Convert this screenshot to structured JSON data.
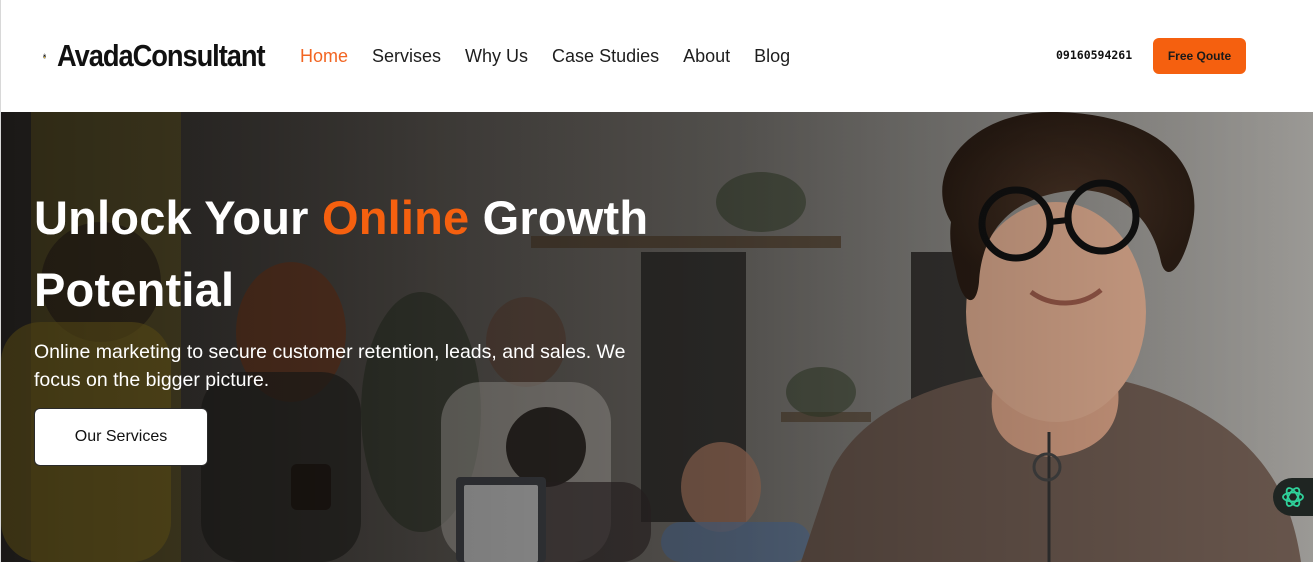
{
  "header": {
    "logo_text": "AvadaConsultant",
    "nav": [
      {
        "label": "Home",
        "active": true
      },
      {
        "label": "Servises",
        "active": false
      },
      {
        "label": "Why Us",
        "active": false
      },
      {
        "label": "Case Studies",
        "active": false
      },
      {
        "label": "About",
        "active": false
      },
      {
        "label": "Blog",
        "active": false
      }
    ],
    "phone": "09160594261",
    "cta_label": "Free Qoute"
  },
  "hero": {
    "title_part1": "Unlock Your ",
    "title_accent": "Online",
    "title_part2": " Growth Potential",
    "subtitle": "Online marketing to secure customer retention, leads, and sales. We focus on the bigger picture.",
    "button_label": "Our Services"
  },
  "widgets": {
    "chat_icon": "openai-chat-icon"
  },
  "colors": {
    "accent": "#f5600f",
    "text_dark": "#1e1e1e",
    "hero_text": "#ffffff"
  }
}
